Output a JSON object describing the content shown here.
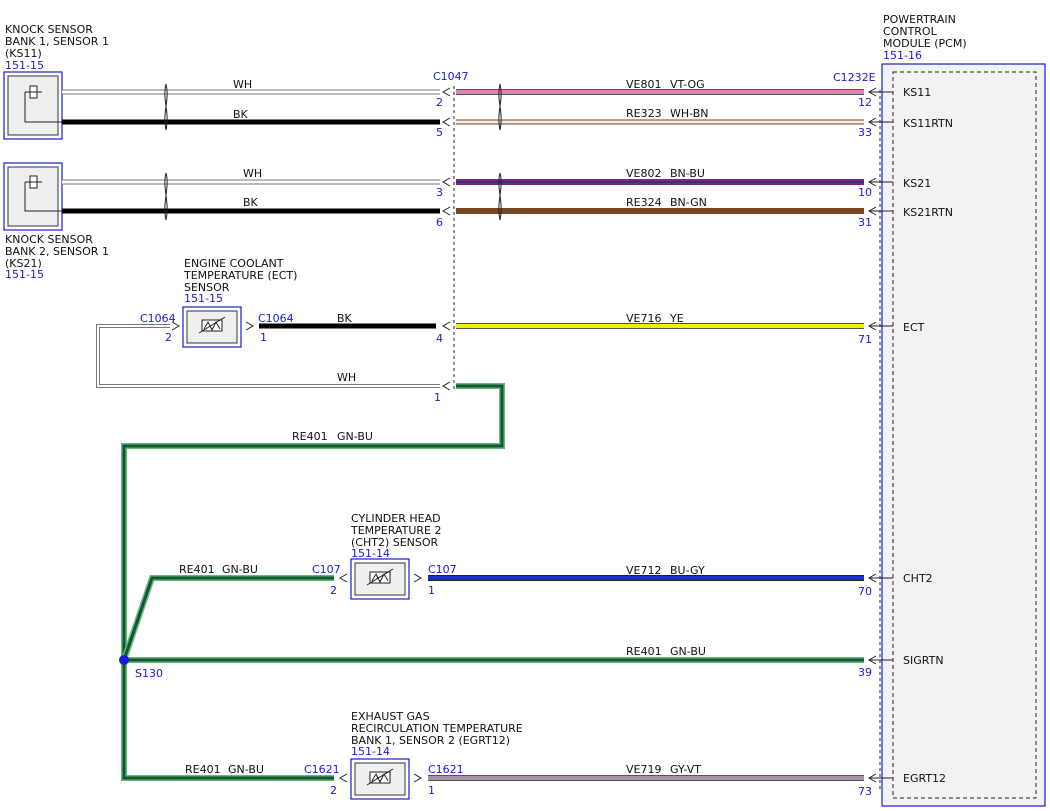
{
  "colors": {
    "ref_blue": "#1a1ad6",
    "wire_black": "#000000",
    "wire_white_outline": "#777777",
    "vt_og": "#e87fb0",
    "wh_bn": "#c7a58a",
    "bn_bu": "#7a2c78",
    "bn_gn": "#7a4522",
    "ye": "#f0f000",
    "gn_bu": "#0f5a2c",
    "bu_gy": "#1a2fd0",
    "gy_vt": "#a894a8"
  },
  "knock1": {
    "title_l1": "KNOCK SENSOR",
    "title_l2": "BANK 1, SENSOR 1",
    "title_l3": "(KS11)",
    "ref": "151-15",
    "wire_top": "WH",
    "wire_bottom": "BK"
  },
  "knock2": {
    "title_l1": "KNOCK SENSOR",
    "title_l2": "BANK 2, SENSOR 1",
    "title_l3": "(KS21)",
    "ref": "151-15",
    "wire_top": "WH",
    "wire_bottom": "BK"
  },
  "ect": {
    "title_l1": "ENGINE COOLANT",
    "title_l2": "TEMPERATURE (ECT)",
    "title_l3": "SENSOR",
    "ref": "151-15",
    "conn_left": "C1064",
    "conn_right": "C1064",
    "pin_left": "2",
    "pin_right": "1",
    "wire_bk": "BK",
    "wire_wh": "WH"
  },
  "c1047": {
    "name": "C1047",
    "pins": [
      "2",
      "5",
      "3",
      "6",
      "4",
      "1"
    ]
  },
  "pcm": {
    "title_l1": "POWERTRAIN",
    "title_l2": "CONTROL",
    "title_l3": "MODULE (PCM)",
    "ref": "151-16",
    "connector": "C1232E",
    "pins": [
      {
        "pin": "12",
        "signal": "KS11"
      },
      {
        "pin": "33",
        "signal": "KS11RTN"
      },
      {
        "pin": "10",
        "signal": "KS21"
      },
      {
        "pin": "31",
        "signal": "KS21RTN"
      },
      {
        "pin": "71",
        "signal": "ECT"
      },
      {
        "pin": "70",
        "signal": "CHT2"
      },
      {
        "pin": "39",
        "signal": "SIGRTN"
      },
      {
        "pin": "73",
        "signal": "EGRT12"
      }
    ]
  },
  "circuits": [
    {
      "id": "VE801",
      "color": "VT-OG"
    },
    {
      "id": "RE323",
      "color": "WH-BN"
    },
    {
      "id": "VE802",
      "color": "BN-BU"
    },
    {
      "id": "RE324",
      "color": "BN-GN"
    },
    {
      "id": "VE716",
      "color": "YE"
    },
    {
      "id": "RE401",
      "color": "GN-BU"
    },
    {
      "id": "VE712",
      "color": "BU-GY"
    },
    {
      "id": "RE401",
      "color": "GN-BU"
    },
    {
      "id": "VE719",
      "color": "GY-VT"
    }
  ],
  "cht2": {
    "title_l1": "CYLINDER HEAD",
    "title_l2": "TEMPERATURE 2",
    "title_l3": "(CHT2) SENSOR",
    "ref": "151-14",
    "conn_left": "C107",
    "conn_right": "C107",
    "pin_left": "2",
    "pin_right": "1",
    "wire_left_id": "RE401",
    "wire_left_color": "GN-BU"
  },
  "splice": {
    "name": "S130"
  },
  "egrt": {
    "title_l1": "EXHAUST GAS",
    "title_l2": "RECIRCULATION TEMPERATURE",
    "title_l3": "BANK 1, SENSOR 2 (EGRT12)",
    "ref": "151-14",
    "conn_left": "C1621",
    "conn_right": "C1621",
    "pin_left": "2",
    "pin_right": "1",
    "wire_left_id": "RE401",
    "wire_left_color": "GN-BU"
  }
}
